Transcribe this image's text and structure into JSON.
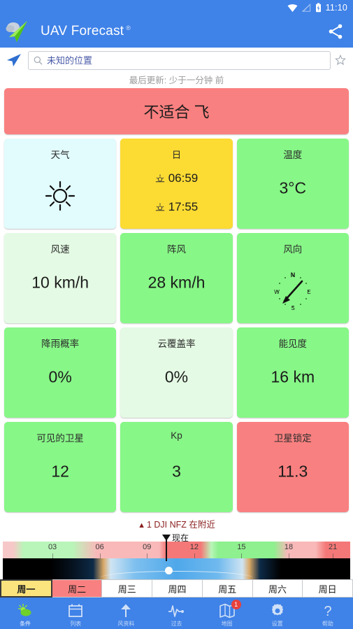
{
  "statusbar": {
    "time": "11:10",
    "wifi_icon": "wifi-icon",
    "signal_icon": "signal-off-icon",
    "battery_icon": "battery-charging-icon"
  },
  "appbar": {
    "title": "UAV Forecast",
    "registered_mark": "®",
    "logo_icon": "uav-forecast-logo",
    "share_icon": "share-icon"
  },
  "search": {
    "location_icon": "my-location-icon",
    "search_icon": "search-icon",
    "placeholder": "未知的位置",
    "value": "",
    "favorite_icon": "star-outline-icon"
  },
  "updated": {
    "text": "最后更新: 少于一分钟 前"
  },
  "banner": {
    "text": "不适合 飞",
    "color": "#f98080"
  },
  "cards": [
    {
      "label": "天气",
      "value": "",
      "icon": "sun-icon",
      "color": "#e2fbfd",
      "kind": "weather"
    },
    {
      "label": "日",
      "sunrise": "06:59",
      "sunset": "17:55",
      "sunrise_icon": "sunrise-icon",
      "sunset_icon": "sunset-icon",
      "color": "#fcdb33",
      "kind": "sun"
    },
    {
      "label": "温度",
      "value": "3°C",
      "color": "#87f787",
      "kind": "value"
    },
    {
      "label": "风速",
      "value": "10 km/h",
      "color": "#e4fae4",
      "kind": "value"
    },
    {
      "label": "阵风",
      "value": "28 km/h",
      "color": "#87f787",
      "kind": "value"
    },
    {
      "label": "风向",
      "value": "",
      "icon": "compass-icon",
      "direction": "SW",
      "color": "#87f787",
      "kind": "compass"
    },
    {
      "label": "降雨概率",
      "value": "0%",
      "color": "#87f787",
      "kind": "value"
    },
    {
      "label": "云覆盖率",
      "value": "0%",
      "color": "#e4fae4",
      "kind": "value"
    },
    {
      "label": "能见度",
      "value": "16 km",
      "color": "#87f787",
      "kind": "value"
    },
    {
      "label": "可见的卫星",
      "value": "12",
      "color": "#87f787",
      "kind": "value"
    },
    {
      "label": "Kp",
      "value": "3",
      "color": "#87f787",
      "kind": "value"
    },
    {
      "label": "卫星锁定",
      "value": "11.3",
      "color": "#f98080",
      "kind": "value"
    }
  ],
  "compass": {
    "n": "N",
    "e": "E",
    "s": "S",
    "w": "W"
  },
  "nfz": {
    "warning_icon": "warning-triangle-icon",
    "text": "1 DJI NFZ 在附近"
  },
  "timeline": {
    "now_label": "现在",
    "now_marker_icon": "now-marker-icon",
    "hours": [
      "03",
      "06",
      "09",
      "12",
      "15",
      "18",
      "21"
    ],
    "hour_positions_pct": [
      14.3,
      27.9,
      41.5,
      55.1,
      68.7,
      82.3,
      95.0
    ]
  },
  "daytabs": [
    {
      "label": "周一",
      "state": "selected"
    },
    {
      "label": "周二",
      "state": "bad"
    },
    {
      "label": "周三",
      "state": "normal"
    },
    {
      "label": "周四",
      "state": "normal"
    },
    {
      "label": "周五",
      "state": "normal"
    },
    {
      "label": "周六",
      "state": "normal"
    },
    {
      "label": "周日",
      "state": "normal"
    }
  ],
  "bottomnav": [
    {
      "label": "条件",
      "icon": "weather-sun-cloud-icon",
      "active": true,
      "badge": ""
    },
    {
      "label": "列表",
      "icon": "calendar-icon",
      "active": false,
      "badge": ""
    },
    {
      "label": "风资料",
      "icon": "arrow-up-icon",
      "active": false,
      "badge": ""
    },
    {
      "label": "过去",
      "icon": "pulse-icon",
      "active": false,
      "badge": ""
    },
    {
      "label": "地图",
      "icon": "map-icon",
      "active": false,
      "badge": "1"
    },
    {
      "label": "设置",
      "icon": "gear-icon",
      "active": false,
      "badge": ""
    },
    {
      "label": "帮助",
      "icon": "question-mark-icon",
      "active": false,
      "badge": ""
    }
  ]
}
